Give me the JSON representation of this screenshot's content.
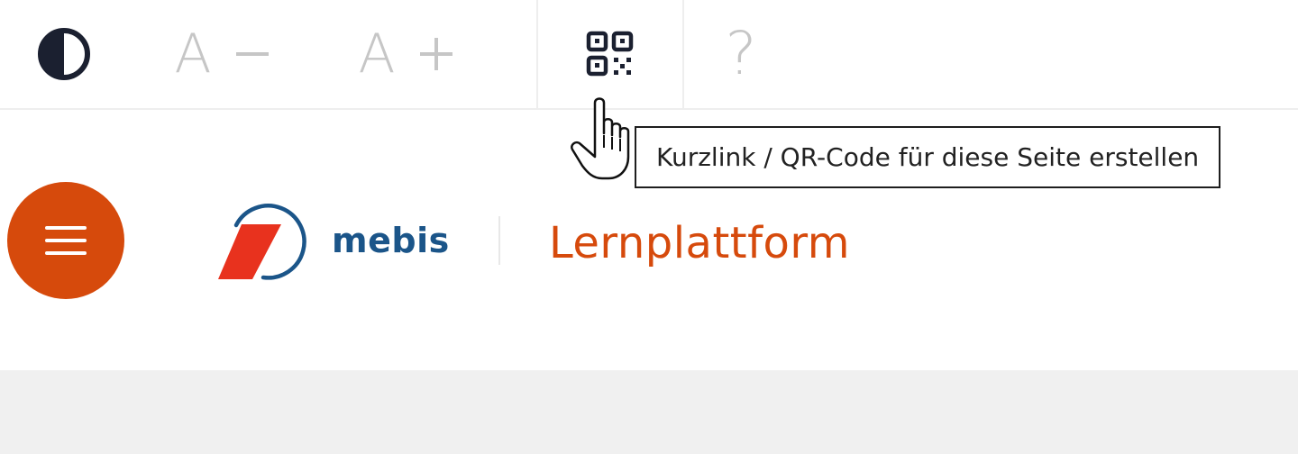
{
  "toolbar": {
    "contrast_icon": "contrast-icon",
    "font_decrease": {
      "glyph": "A",
      "icon": "minus-icon"
    },
    "font_increase": {
      "glyph": "A",
      "icon": "plus-icon"
    },
    "qr_icon": "qr-code-icon",
    "help": {
      "glyph": "?",
      "icon": "help-icon"
    }
  },
  "tooltip": {
    "text": "Kurzlink / QR-Code für diese Seite erstellen"
  },
  "header": {
    "menu_icon": "hamburger-menu-icon",
    "brand_name": "mebis",
    "product_name": "Lernplattform"
  },
  "colors": {
    "accent": "#d64a0c",
    "brand_blue": "#1b5589",
    "logo_red": "#e8321e",
    "muted": "#c6c6c6"
  }
}
